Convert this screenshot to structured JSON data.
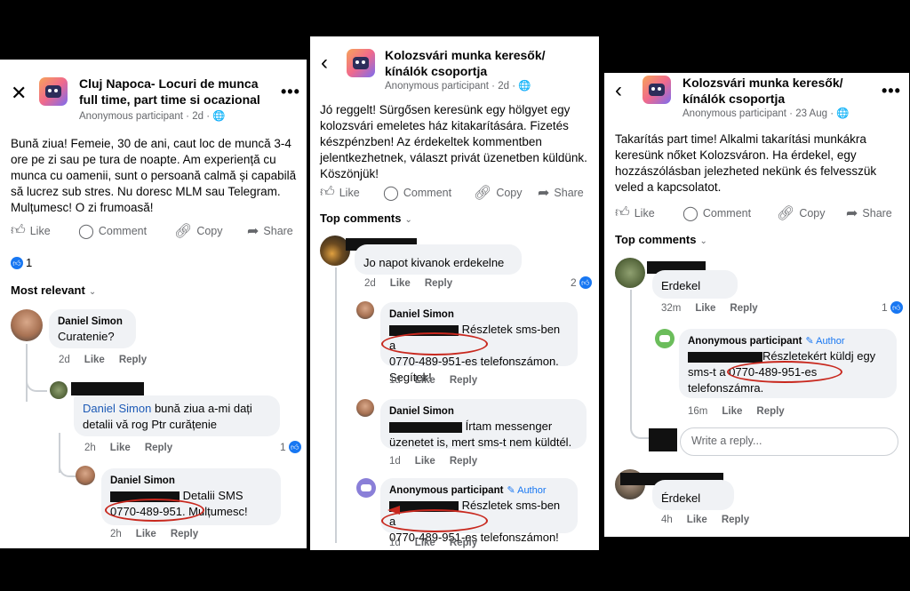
{
  "panel1": {
    "group_title": "Cluj Napoca- Locuri de munca full time, part time si ocazional",
    "meta": "Anonymous participant · 2d · 🌐",
    "post_text": "Bună ziua! Femeie, 30 de ani, caut loc de muncă 3-4 ore pe zi sau pe tura de noapte. Am experiență cu munca cu oamenii, sunt o persoană calmă și capabilă să lucrez sub stres. Nu doresc MLM sau Telegram. Mulțumesc! O zi frumoasă!",
    "actions": [
      "Like",
      "Comment",
      "Copy",
      "Share"
    ],
    "reaction_count": "1",
    "sort_label": "Most relevant",
    "comments": [
      {
        "author": "Daniel Simon",
        "text": "Curatenie?",
        "time": "2d",
        "like": "Like",
        "reply": "Reply"
      },
      {
        "tag": "Daniel Simon",
        "text": "bună ziua a-mi dați detalii vă rog Ptr curățenie",
        "time": "2h",
        "like": "Like",
        "reply": "Reply",
        "reactions": "1"
      },
      {
        "author": "Daniel Simon",
        "text_a": "Detalii SMS",
        "text_b": "0770-489-951. Mulțumesc!",
        "time": "2h",
        "like": "Like",
        "reply": "Reply"
      }
    ]
  },
  "panel2": {
    "group_title": "Kolozsvári munka keresők/ kínálók csoportja",
    "meta": "Anonymous participant · 2d · 🌐",
    "post_text": "Jó reggelt! Sürgősen keresünk egy hölgyet egy kolozsvári emeletes ház kitakarítására. Fizetés készpénzben! Az érdekeltek kommentben jelentkezhetnek, választ privát üzenetben küldünk. Köszönjük!",
    "actions": [
      "Like",
      "Comment",
      "Copy",
      "Share"
    ],
    "sort_label": "Top comments",
    "comments": [
      {
        "text": "Jo napot kivanok  erdekelne",
        "time": "2d",
        "like": "Like",
        "reply": "Reply",
        "reactions": "2"
      },
      {
        "author": "Daniel Simon",
        "text_a": "Részletek sms-ben a",
        "text_b": "0770-489-951-es telefonszámon. Segítek!",
        "time": "1d",
        "like": "Like",
        "reply": "Reply"
      },
      {
        "author": "Daniel Simon",
        "text_a": "Írtam messenger",
        "text_b": "üzenetet is, mert sms-t nem küldtél.",
        "time": "1d",
        "like": "Like",
        "reply": "Reply"
      },
      {
        "author": "Anonymous participant",
        "author_tag": "✎ Author",
        "text_a": "Részletek sms-ben a",
        "text_b": "0770-489-951-es telefonszámon!",
        "time": "1d",
        "like": "Like",
        "reply": "Reply"
      }
    ]
  },
  "panel3": {
    "group_title": "Kolozsvári munka keresők/ kínálók csoportja",
    "meta": "Anonymous participant · 23 Aug · 🌐",
    "post_text": "Takarítás part time! Alkalmi takarítási munkákra keresünk nőket Kolozsváron. Ha érdekel, egy hozzászólásban jelezheted nekünk és felvesszük veled a kapcsolatot.",
    "actions": [
      "Like",
      "Comment",
      "Copy",
      "Share"
    ],
    "sort_label": "Top comments",
    "comments": [
      {
        "text": "Erdekel",
        "time": "32m",
        "like": "Like",
        "reply": "Reply",
        "reactions": "1"
      },
      {
        "author": "Anonymous participant",
        "author_tag": "✎ Author",
        "text_a": "Részletekért küldj egy",
        "text_b": "sms-t a 0770-489-951-es",
        "text_c": "telefonszámra.",
        "time": "16m",
        "like": "Like",
        "reply": "Reply"
      },
      {
        "text": "Érdekel",
        "time": "4h",
        "like": "Like",
        "reply": "Reply"
      }
    ],
    "reply_placeholder": "Write a reply..."
  }
}
